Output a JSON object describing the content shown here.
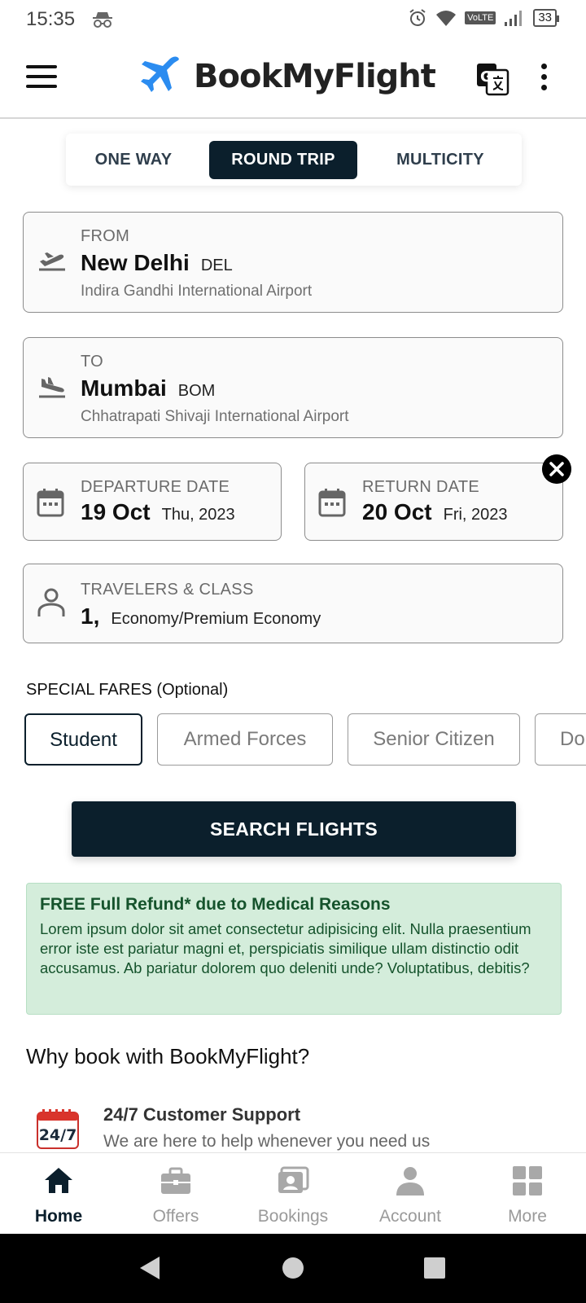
{
  "status_bar": {
    "time": "15:35",
    "network": "VoLTE",
    "battery": "33"
  },
  "app": {
    "name": "BookMyFlight"
  },
  "trip_tabs": [
    {
      "label": "ONE WAY",
      "active": false
    },
    {
      "label": "ROUND TRIP",
      "active": true
    },
    {
      "label": "MULTICITY",
      "active": false
    }
  ],
  "from": {
    "label": "FROM",
    "city": "New Delhi",
    "code": "DEL",
    "airport": "Indira Gandhi International Airport"
  },
  "to": {
    "label": "TO",
    "city": "Mumbai",
    "code": "BOM",
    "airport": "Chhatrapati Shivaji International Airport"
  },
  "departure": {
    "label": "DEPARTURE DATE",
    "date": "19 Oct",
    "day_year": "Thu, 2023"
  },
  "return": {
    "label": "RETURN DATE",
    "date": "20 Oct",
    "day_year": "Fri, 2023"
  },
  "travelers": {
    "label": "TRAVELERS & CLASS",
    "count": "1,",
    "class": "Economy/Premium Economy"
  },
  "special_fares": {
    "title": "SPECIAL FARES (Optional)",
    "options": [
      {
        "label": "Student",
        "selected": true
      },
      {
        "label": "Armed Forces",
        "selected": false
      },
      {
        "label": "Senior Citizen",
        "selected": false
      },
      {
        "label": "Dou",
        "selected": false
      }
    ]
  },
  "search_button": "SEARCH FLIGHTS",
  "refund": {
    "title": "FREE Full Refund* due to Medical Reasons",
    "text": "Lorem ipsum dolor sit amet consectetur adipisicing elit. Nulla praesentium error iste est pariatur magni et, perspiciatis similique ullam distinctio odit accusamus. Ab pariatur dolorem quo deleniti unde? Voluptatibus, debitis?"
  },
  "why": {
    "title": "Why book with BookMyFlight?",
    "features": [
      {
        "icon_text": "24/7",
        "title": "24/7 Customer Support",
        "desc": "We are here to help whenever you need us"
      }
    ]
  },
  "bottom_nav": [
    {
      "label": "Home",
      "icon": "home-icon",
      "active": true
    },
    {
      "label": "Offers",
      "icon": "briefcase-icon",
      "active": false
    },
    {
      "label": "Bookings",
      "icon": "bookings-icon",
      "active": false
    },
    {
      "label": "Account",
      "icon": "person-icon",
      "active": false
    },
    {
      "label": "More",
      "icon": "grid-icon",
      "active": false
    }
  ],
  "colors": {
    "primary": "#0b1f2c",
    "brand_blue": "#2b8cf0",
    "refund_bg": "#d4eddb",
    "refund_text": "#15532c"
  }
}
